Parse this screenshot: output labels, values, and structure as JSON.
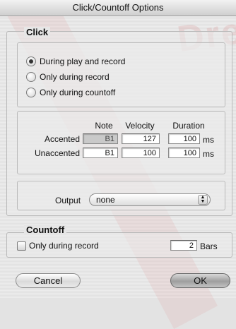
{
  "window": {
    "title": "Click/Countoff Options"
  },
  "click_group": {
    "legend": "Click",
    "radios": [
      {
        "label": "During play and record",
        "checked": true
      },
      {
        "label": "Only during record",
        "checked": false
      },
      {
        "label": "Only during countoff",
        "checked": false
      }
    ],
    "columns": {
      "note": "Note",
      "velocity": "Velocity",
      "duration": "Duration"
    },
    "rows": [
      {
        "label": "Accented",
        "note": "B1",
        "velocity": "127",
        "duration": "100",
        "unit": "ms"
      },
      {
        "label": "Unaccented",
        "note": "B1",
        "velocity": "100",
        "duration": "100",
        "unit": "ms"
      }
    ],
    "output_label": "Output",
    "output_value": "none"
  },
  "countoff_group": {
    "legend": "Countoff",
    "checkbox_label": "Only during record",
    "checkbox_checked": false,
    "bars_value": "2",
    "bars_unit": "Bars"
  },
  "buttons": {
    "cancel": "Cancel",
    "ok": "OK"
  }
}
